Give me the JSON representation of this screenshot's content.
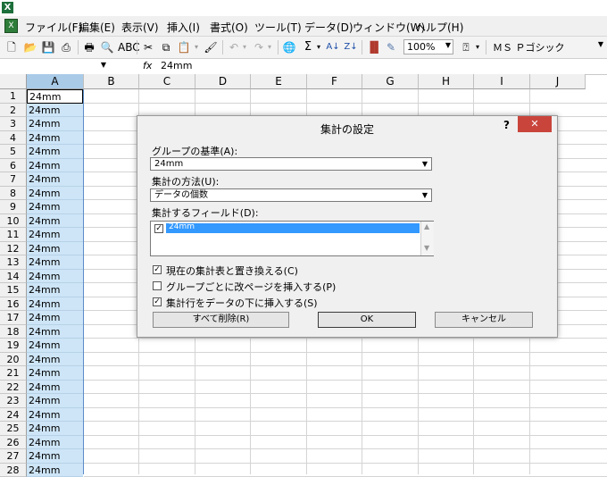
{
  "menu": {
    "items": [
      "ファイル(F)",
      "編集(E)",
      "表示(V)",
      "挿入(I)",
      "書式(O)",
      "ツール(T)",
      "データ(D)",
      "ウィンドウ(W)",
      "ヘルプ(H)"
    ]
  },
  "toolbar": {
    "zoom": "100%",
    "font": "ＭＳ Ｐゴシック",
    "sigma": "Σ"
  },
  "formula": {
    "fx": "fx",
    "value": "24mm"
  },
  "grid": {
    "columns": [
      "A",
      "B",
      "C",
      "D",
      "E",
      "F",
      "G",
      "H",
      "I",
      "J"
    ],
    "rows": [
      "1",
      "2",
      "3",
      "4",
      "5",
      "6",
      "7",
      "8",
      "9",
      "10",
      "11",
      "12",
      "13",
      "14",
      "15",
      "16",
      "17",
      "18",
      "19",
      "20",
      "21",
      "22",
      "23",
      "24",
      "25",
      "26",
      "27",
      "28"
    ],
    "cell_value": "24mm"
  },
  "dialog": {
    "title": "集計の設定",
    "help": "?",
    "close": "✕",
    "group_by_label": "グループの基準(A):",
    "group_by_value": "24mm",
    "function_label": "集計の方法(U):",
    "function_value": "データの個数",
    "fields_label": "集計するフィールド(D):",
    "field_item": "24mm",
    "replace_label": "現在の集計表と置き換える(C)",
    "pagebreak_label": "グループごとに改ページを挿入する(P)",
    "summary_below_label": "集計行をデータの下に挿入する(S)",
    "remove_all": "すべて削除(R)",
    "ok": "OK",
    "cancel": "キャンセル"
  },
  "colors": {
    "selection": "#cde5f7",
    "dialog_bg": "#f0f0f0",
    "close_red": "#c9453c",
    "list_highlight": "#3399ff"
  }
}
